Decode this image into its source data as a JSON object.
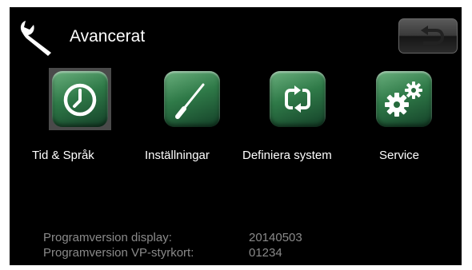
{
  "header": {
    "title": "Avancerat",
    "icon": "wrench-icon",
    "back_icon": "back-arrow-icon"
  },
  "menu": [
    {
      "label": "Tid & Språk",
      "icon": "clock-icon",
      "selected": true
    },
    {
      "label": "Inställningar",
      "icon": "screwdriver-icon",
      "selected": false
    },
    {
      "label": "Definiera system",
      "icon": "cycle-arrows-icon",
      "selected": false
    },
    {
      "label": "Service",
      "icon": "gears-icon",
      "selected": false
    }
  ],
  "info": {
    "display_label": "Programversion display:",
    "display_value": "20140503",
    "board_label": "Programversion VP-styrkort:",
    "board_value": "01234"
  },
  "colors": {
    "background": "#000000",
    "tile_green": "#2f7a48",
    "text_primary": "#ffffff",
    "text_secondary": "#8a8a8a",
    "selection": "#4a4a4a"
  }
}
